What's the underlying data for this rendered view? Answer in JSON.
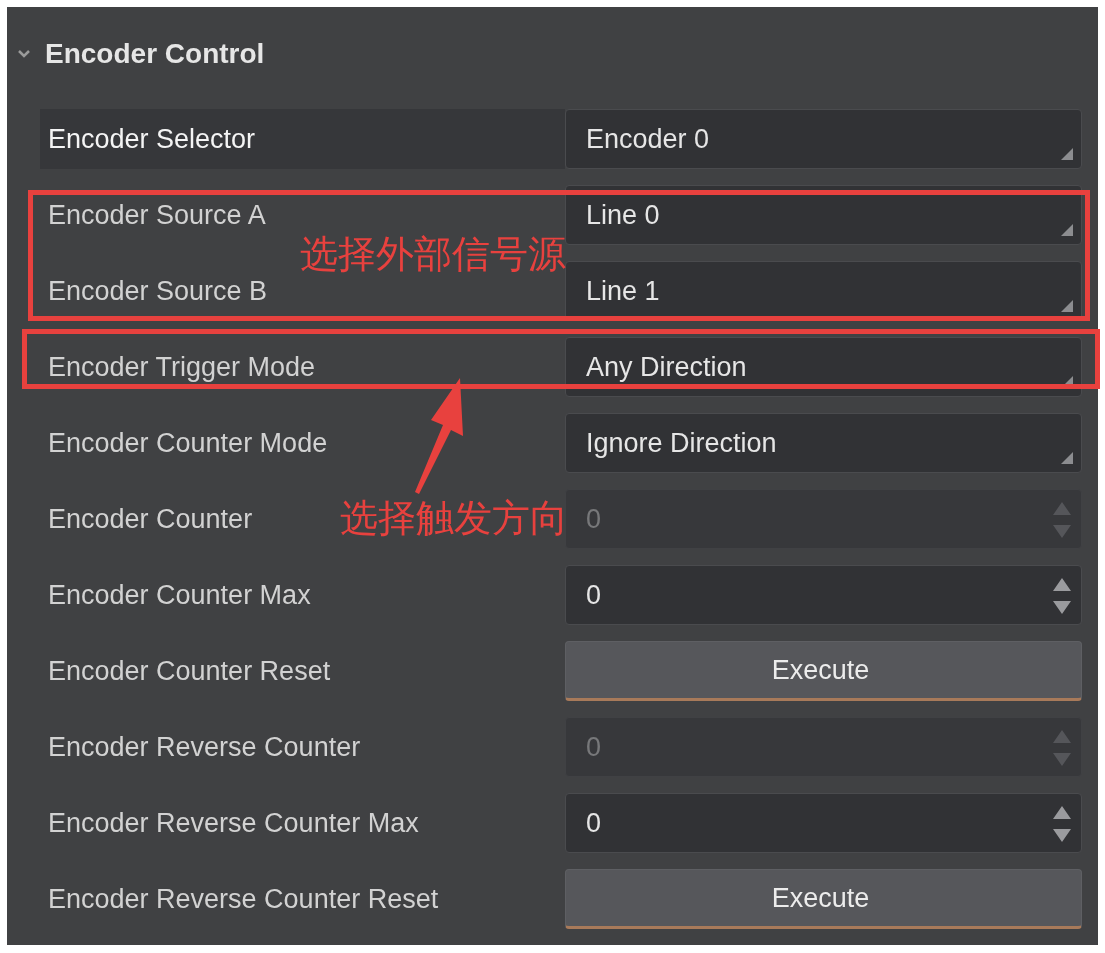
{
  "section": {
    "title": "Encoder Control",
    "expanded": true
  },
  "rows": [
    {
      "label": "Encoder Selector",
      "kind": "dropdown",
      "value": "Encoder 0",
      "selected": true,
      "disabled": false
    },
    {
      "label": "Encoder Source A",
      "kind": "dropdown",
      "value": "Line 0",
      "selected": false,
      "disabled": false
    },
    {
      "label": "Encoder Source B",
      "kind": "dropdown",
      "value": "Line 1",
      "selected": false,
      "disabled": false
    },
    {
      "label": "Encoder Trigger Mode",
      "kind": "dropdown",
      "value": "Any Direction",
      "selected": false,
      "disabled": false
    },
    {
      "label": "Encoder Counter Mode",
      "kind": "dropdown",
      "value": "Ignore Direction",
      "selected": false,
      "disabled": false
    },
    {
      "label": "Encoder Counter",
      "kind": "spin",
      "value": "0",
      "selected": false,
      "disabled": true
    },
    {
      "label": "Encoder Counter Max",
      "kind": "spin",
      "value": "0",
      "selected": false,
      "disabled": false
    },
    {
      "label": "Encoder Counter Reset",
      "kind": "button",
      "value": "Execute",
      "selected": false,
      "disabled": false
    },
    {
      "label": "Encoder Reverse Counter",
      "kind": "spin",
      "value": "0",
      "selected": false,
      "disabled": true
    },
    {
      "label": "Encoder Reverse Counter Max",
      "kind": "spin",
      "value": "0",
      "selected": false,
      "disabled": false
    },
    {
      "label": "Encoder Reverse Counter Reset",
      "kind": "button",
      "value": "Execute",
      "selected": false,
      "disabled": false
    }
  ],
  "callouts": [
    {
      "text": "选择外部信号源",
      "arrow": false
    },
    {
      "text": "选择触发方向",
      "arrow": true
    }
  ]
}
